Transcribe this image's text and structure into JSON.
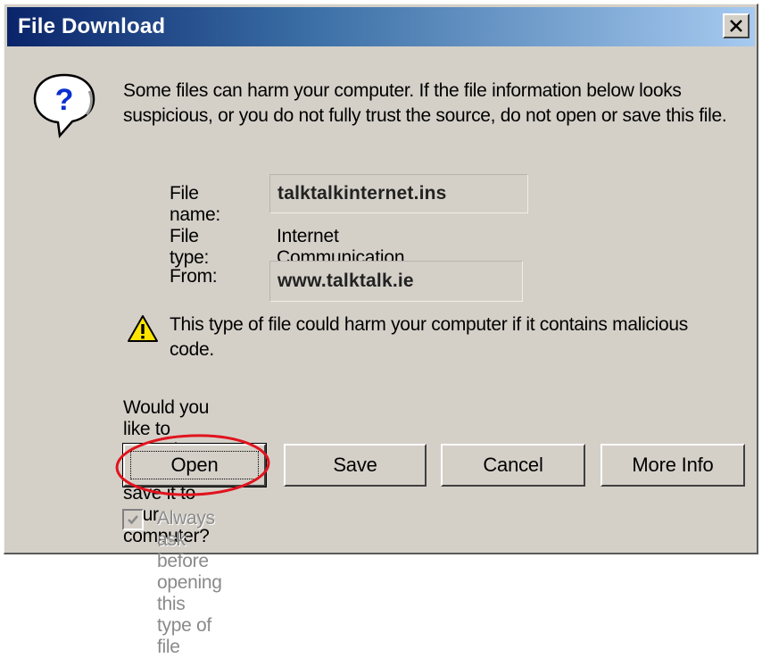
{
  "dialog": {
    "title": "File Download",
    "close_glyph": "✕"
  },
  "message": "Some files can harm your computer. If the file information below looks suspicious, or you do not fully trust the source, do not open or save this file.",
  "file_info": {
    "name_label": "File name:",
    "name_value": "talktalkinternet.ins",
    "type_label": "File type:",
    "type_value": "Internet Communication Settings",
    "from_label": "From:",
    "from_value": "www.talktalk.ie"
  },
  "warning": "This type of file could harm your computer if it contains malicious code.",
  "question": "Would you like to open the file or save it to your computer?",
  "buttons": {
    "open": "Open",
    "save": "Save",
    "cancel": "Cancel",
    "more_info": "More Info"
  },
  "checkbox": {
    "label": "Always ask before opening this type of file",
    "checked": true,
    "disabled": true
  },
  "icons": {
    "question": "question-icon",
    "warning": "warning-icon",
    "close": "close-icon"
  },
  "colors": {
    "title_gradient_start": "#0a246a",
    "title_gradient_end": "#a6caf0",
    "dialog_face": "#d4d0c8",
    "annotation_circle": "#e0141e"
  }
}
